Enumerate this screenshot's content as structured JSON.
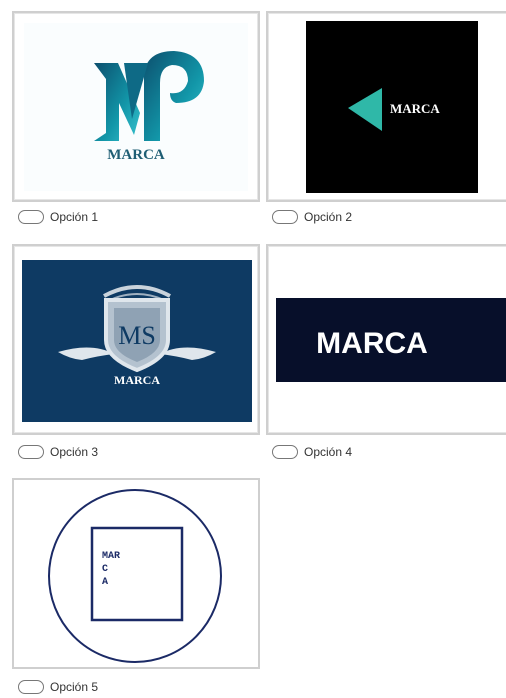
{
  "options": [
    {
      "label": "Opción 1",
      "brand": "MARCA",
      "monogram": "M",
      "accent": "#0f8e9f",
      "text_color": "#1f5e74"
    },
    {
      "label": "Opción 2",
      "brand": "MARCA",
      "accent": "#2fb8a8",
      "bg": "#000000"
    },
    {
      "label": "Opción 3",
      "brand": "MARCA",
      "monogram": "MS",
      "bg": "#0e3a63"
    },
    {
      "label": "Opción 4",
      "brand": "MARCA",
      "bg": "#070f2a"
    },
    {
      "label": "Opción 5",
      "brand_lines": [
        "MAR",
        "C",
        "A"
      ],
      "stroke": "#1b2a66"
    }
  ],
  "colors": {
    "card_border": "#cfcfcf",
    "radio_border": "#777777",
    "label_text": "#333333"
  }
}
